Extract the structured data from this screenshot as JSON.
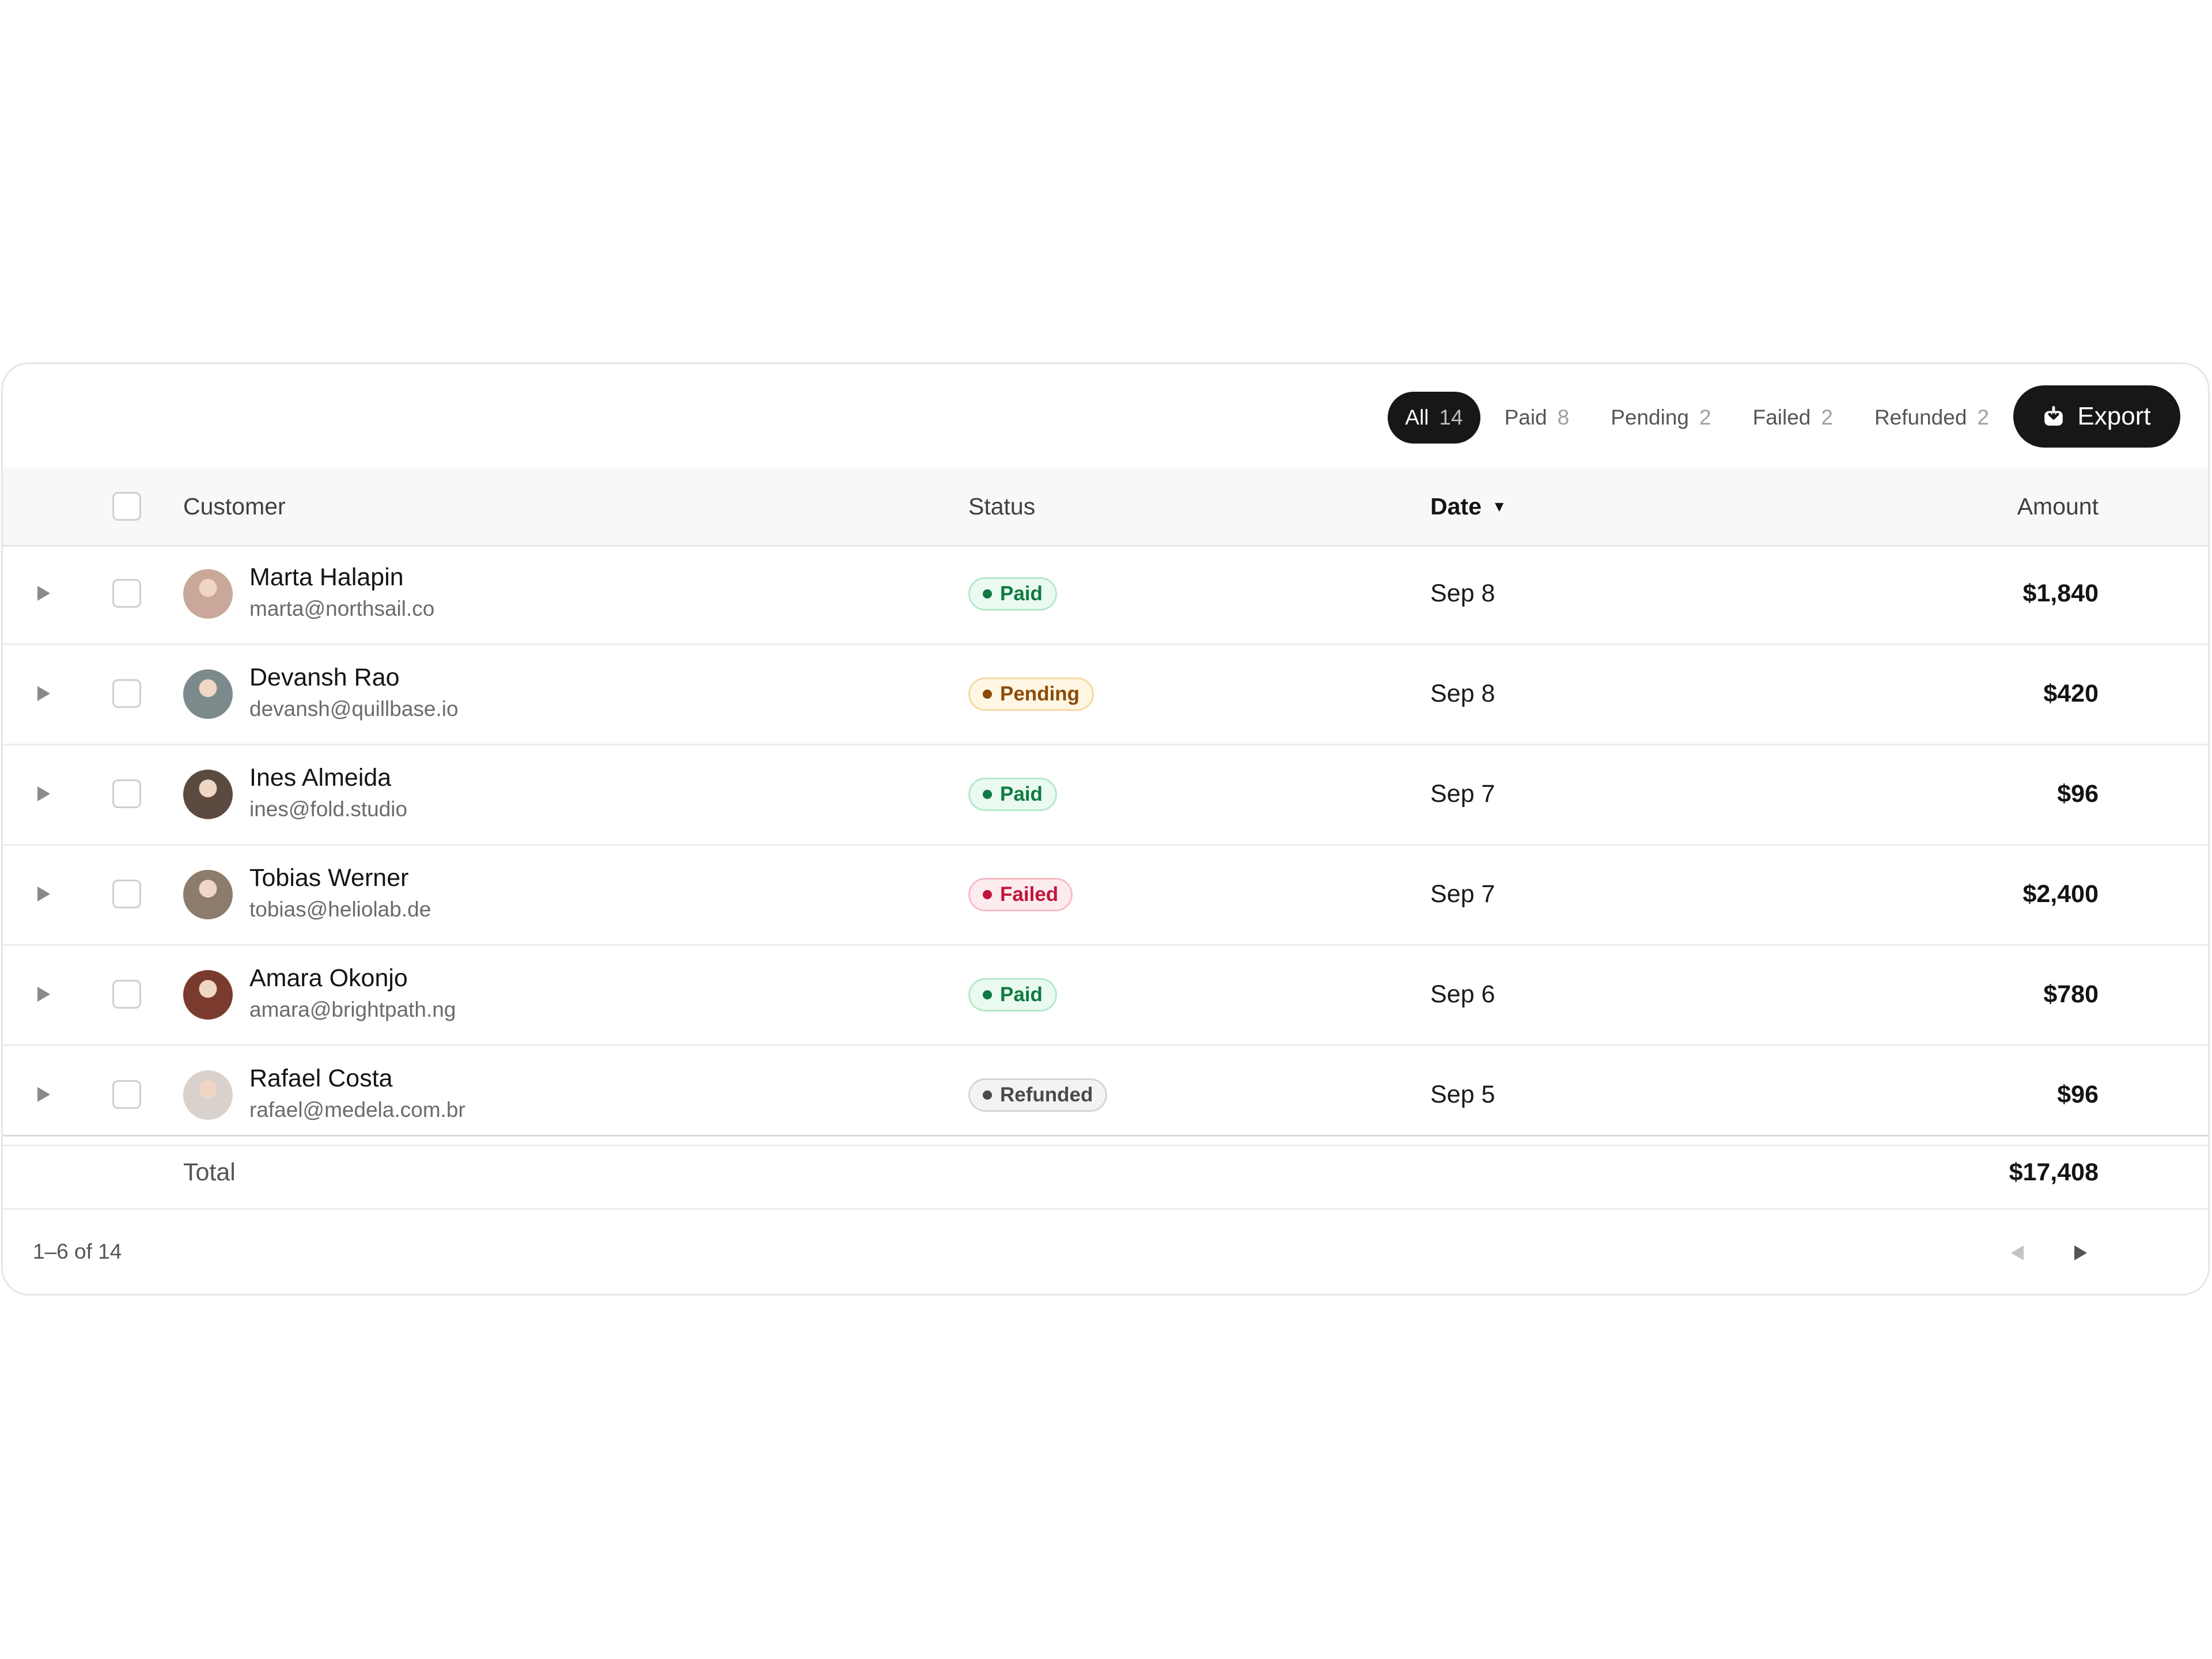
{
  "filters": [
    {
      "label": "All",
      "count": "14",
      "active": true
    },
    {
      "label": "Paid",
      "count": "8",
      "active": false
    },
    {
      "label": "Pending",
      "count": "2",
      "active": false
    },
    {
      "label": "Failed",
      "count": "2",
      "active": false
    },
    {
      "label": "Refunded",
      "count": "2",
      "active": false
    }
  ],
  "export_label": "Export",
  "columns": {
    "customer": "Customer",
    "status": "Status",
    "date": "Date",
    "amount": "Amount"
  },
  "sort": {
    "column": "date",
    "direction": "descending",
    "icon": "triangle-down-icon"
  },
  "rows": [
    {
      "name": "Marta Halapin",
      "email": "marta@northsail.co",
      "status": "Paid",
      "date": "Sep 8",
      "amount": "$1,840",
      "avatar_color": "#c9a89a"
    },
    {
      "name": "Devansh Rao",
      "email": "devansh@quillbase.io",
      "status": "Pending",
      "date": "Sep 8",
      "amount": "$420",
      "avatar_color": "#7d8a8c"
    },
    {
      "name": "Ines Almeida",
      "email": "ines@fold.studio",
      "status": "Paid",
      "date": "Sep 7",
      "amount": "$96",
      "avatar_color": "#5b4a3f"
    },
    {
      "name": "Tobias Werner",
      "email": "tobias@heliolab.de",
      "status": "Failed",
      "date": "Sep 7",
      "amount": "$2,400",
      "avatar_color": "#8d7b6c"
    },
    {
      "name": "Amara Okonjo",
      "email": "amara@brightpath.ng",
      "status": "Paid",
      "date": "Sep 6",
      "amount": "$780",
      "avatar_color": "#7a3b2e"
    },
    {
      "name": "Rafael Costa",
      "email": "rafael@medela.com.br",
      "status": "Refunded",
      "date": "Sep 5",
      "amount": "$96",
      "avatar_color": "#d9d2cc"
    }
  ],
  "status_styles": {
    "Paid": {
      "bg": "#eafaf1",
      "border": "#b6e8cb",
      "text": "#0f7a43",
      "dot": "#0f7a43"
    },
    "Pending": {
      "bg": "#fff6e3",
      "border": "#f5d9a4",
      "text": "#8a4b08",
      "dot": "#8a4b08"
    },
    "Failed": {
      "bg": "#fdecef",
      "border": "#f6bcc7",
      "text": "#c0153b",
      "dot": "#c0153b"
    },
    "Refunded": {
      "bg": "#f3f3f3",
      "border": "#d6d6d6",
      "text": "#4a4a4a",
      "dot": "#4a4a4a"
    }
  },
  "total": {
    "label": "Total",
    "amount": "$17,408"
  },
  "pagination": {
    "range": "1–6 of 14"
  }
}
